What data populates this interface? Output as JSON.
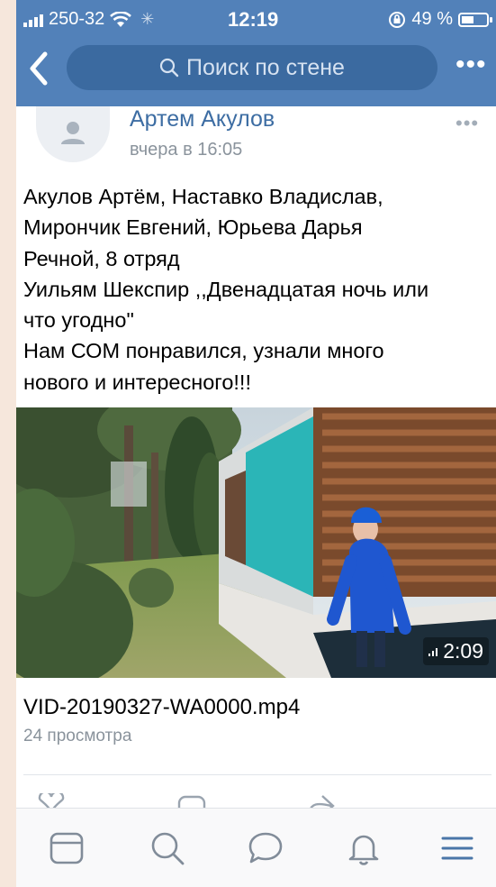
{
  "status_bar": {
    "carrier": "250-32",
    "time": "12:19",
    "battery_text": "49 %",
    "battery_level": 0.49
  },
  "nav": {
    "search_placeholder": "Поиск по стене",
    "more_label": "•••"
  },
  "post": {
    "author": "Артем Акулов",
    "time": "вчера в 16:05",
    "menu_label": "•••",
    "text_lines": [
      "Акулов Артём, Наставко Владислав,",
      "Мирончик Евгений, Юрьева Дарья",
      "Речной, 8 отряд",
      "Уильям Шекспир ,,Двенадцатая ночь или",
      "что угодно\"",
      "Нам СОМ понравился, узнали много",
      "нового и интересного!!!"
    ],
    "video": {
      "duration": "2:09",
      "filename": "VID-20190327-WA0000.mp4",
      "views": "24 просмотра"
    }
  },
  "tabbar": {
    "icons": [
      "newsfeed-icon",
      "search-icon",
      "messages-icon",
      "notifications-icon",
      "menu-icon"
    ],
    "active_color": "#4a76a8",
    "icon_color": "#818c99"
  },
  "colors": {
    "header_bg": "#5281b9",
    "search_bg": "#3b6aa0",
    "link": "#3d6da3",
    "secondary_text": "#8a939c"
  }
}
